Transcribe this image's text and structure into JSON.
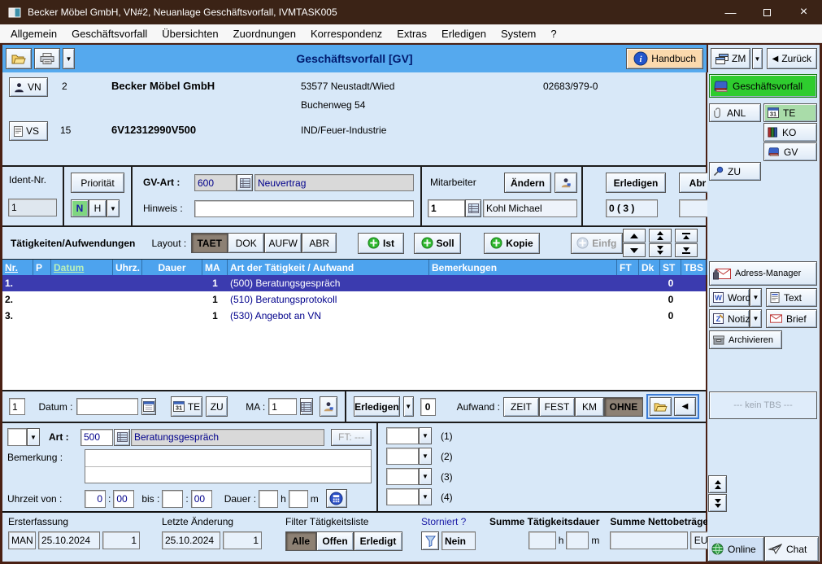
{
  "window": {
    "title": "Becker Möbel GmbH, VN#2, Neuanlage Geschäftsvorfall, IVMTASK005"
  },
  "menu": {
    "items": [
      "Allgemein",
      "Geschäftsvorfall",
      "Übersichten",
      "Zuordnungen",
      "Korrespondenz",
      "Extras",
      "Erledigen",
      "System",
      "?"
    ]
  },
  "toolbar": {
    "gv_title": "Geschäftsvorfall [GV]",
    "handbuch": "Handbuch",
    "zm": "ZM",
    "zurueck": "Zurück"
  },
  "header": {
    "vn": {
      "button": "VN",
      "nr": "2",
      "name": "Becker Möbel GmbH",
      "plz_ort": "53577 Neustadt/Wied",
      "strasse": "Buchenweg 54",
      "telefon": "02683/979-0"
    },
    "vs": {
      "button": "VS",
      "nr": "15",
      "vsnr": "6V12312990V500",
      "sparte": "IND/Feuer-Industrie"
    }
  },
  "form": {
    "ident_label": "Ident-Nr.",
    "ident_value": "1",
    "prioritaet": "Priorität",
    "prio_n": "N",
    "prio_h": "H",
    "gv_art_label": "GV-Art :",
    "gv_art_code": "600",
    "gv_art_name": "Neuvertrag",
    "hinweis_label": "Hinweis :",
    "hinweis_value": "",
    "mitarbeiter_label": "Mitarbeiter",
    "aendern": "Ändern",
    "ma_nr": "1",
    "ma_name": "Kohl Michael",
    "erledigen": "Erledigen",
    "abr": "Abr",
    "offen_count": "0 ( 3 )"
  },
  "activities": {
    "title": "Tätigkeiten/Aufwendungen",
    "layout_label": "Layout :",
    "layouts": [
      "TAET",
      "DOK",
      "AUFW",
      "ABR"
    ],
    "active_layout": "TAET",
    "ist": "Ist",
    "soll": "Soll",
    "kopie": "Kopie",
    "einfg": "Einfg",
    "table": {
      "columns": [
        "Nr.",
        "P",
        "Datum",
        "Uhrz.",
        "Dauer",
        "MA",
        "Art der Tätigkeit / Aufwand",
        "Bemerkungen",
        "FT",
        "Dk",
        "ST",
        "TBS"
      ],
      "rows": [
        {
          "nr": "1.",
          "ma": "1",
          "art": "(500)  Beratungsgespräch",
          "st": "0",
          "selected": true
        },
        {
          "nr": "2.",
          "ma": "1",
          "art": "(510)  Beratungsprotokoll",
          "st": "0",
          "selected": false
        },
        {
          "nr": "3.",
          "ma": "1",
          "art": "(530)  Angebot an VN",
          "st": "0",
          "selected": false
        }
      ]
    }
  },
  "detail": {
    "nr": "1",
    "datum_label": "Datum :",
    "datum": "",
    "te": "TE",
    "zu": "ZU",
    "ma_label": "MA :",
    "ma": "1",
    "erledigen": "Erledigen",
    "zahl": "0",
    "aufwand_label": "Aufwand :",
    "aufwand": [
      "ZEIT",
      "FEST",
      "KM",
      "OHNE"
    ],
    "active_aufwand": "OHNE",
    "art_label": "Art :",
    "art_code": "500",
    "art_name": "Beratungsgespräch",
    "ft": "FT: ---",
    "bemerkung_label": "Bemerkung :",
    "bemerkung": "",
    "uhrzeit_label": "Uhrzeit von :",
    "von_std": "0",
    "von_min": "00",
    "bis_label": "bis :",
    "bis_std": "",
    "bis_min": "00",
    "dauer_label": "Dauer :",
    "dauer_h": "",
    "h": "h",
    "dauer_m": "",
    "m": "m",
    "slots": [
      "(1)",
      "(2)",
      "(3)",
      "(4)"
    ]
  },
  "status": {
    "erst_label": "Ersterfassung",
    "erst_art": "MAN",
    "erst_datum": "25.10.2024",
    "erst_user": "1",
    "aend_label": "Letzte Änderung",
    "aend_datum": "25.10.2024",
    "aend_user": "1",
    "filter_label": "Filter Tätigkeitsliste",
    "filters": [
      "Alle",
      "Offen",
      "Erledigt"
    ],
    "active_filter": "Alle",
    "storniert_label": "Storniert ?",
    "storniert": "Nein",
    "dauer_label": "Summe Tätigkeitsdauer",
    "h": "h",
    "m": "m",
    "netto_label": "Summe Nettobeträge",
    "eur": "EUR"
  },
  "sidebar": {
    "gv_button": "Geschäftsvorfall",
    "anl": "ANL",
    "te": "TE",
    "ko": "KO",
    "gv": "GV",
    "zu": "ZU",
    "adress": "Adress-Manager",
    "word": "Word",
    "text": "Text",
    "notiz": "Notiz",
    "brief": "Brief",
    "archiv": "Archivieren",
    "tbs": "---  kein TBS  ---",
    "online": "Online",
    "chat": "Chat"
  },
  "colors": {
    "accent_blue": "#55a9ee",
    "table_header": "#4da3ee",
    "selected_row": "#3b3baf",
    "pressed": "#8d8174",
    "green_button": "#2ecc2e",
    "handbuch_bg": "#fbd9ad"
  }
}
